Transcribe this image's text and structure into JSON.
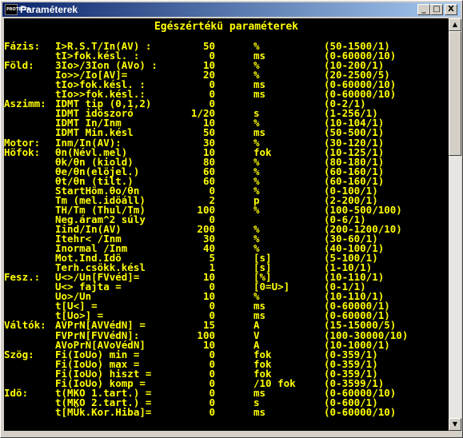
{
  "window": {
    "title": "Paraméterek",
    "app_icon_text": "PROTECTA"
  },
  "titlebar_buttons": {
    "minimize": "_",
    "maximize": "□",
    "close": "X"
  },
  "scrollbar": {
    "up": "▲",
    "down": "▼"
  },
  "header": "Egészértékü paraméterek",
  "rows": [
    {
      "group": "Fázis:",
      "name": "I>R.S.T/In(AV) :",
      "value": "50",
      "unit": "%",
      "range": "(50-1500/1)"
    },
    {
      "group": "",
      "name": "tI>fok.késl. :",
      "value": "0",
      "unit": "ms",
      "range": "(0-60000/10)"
    },
    {
      "group": "Föld:",
      "name": "3Io>/3Ion (AVo) :",
      "value": "10",
      "unit": "%",
      "range": "(10-200/1)"
    },
    {
      "group": "",
      "name": "Io>>/Io[AV]=",
      "value": "20",
      "unit": "%",
      "range": "(20-2500/5)"
    },
    {
      "group": "",
      "name": "tIo>fok.késl. :",
      "value": "0",
      "unit": "ms",
      "range": "(0-60000/10)"
    },
    {
      "group": "",
      "name": "tIo>>fok.késl.:",
      "value": "0",
      "unit": "ms",
      "range": "(0-60000/10)"
    },
    {
      "group": "Aszimm:",
      "name": "IDMT tip (0,1,2)",
      "value": "0",
      "unit": "",
      "range": "(0-2/1)"
    },
    {
      "group": "",
      "name": "IDMT idöszoró",
      "value": "1/20",
      "unit": "s",
      "range": "(1-256/1)"
    },
    {
      "group": "",
      "name": "IDMT In/Inm",
      "value": "10",
      "unit": "%",
      "range": "(10-104/1)"
    },
    {
      "group": "",
      "name": "IDMT Min.késl",
      "value": "50",
      "unit": "ms",
      "range": "(50-500/1)"
    },
    {
      "group": "Motor:",
      "name": "Inm/In(AV):",
      "value": "30",
      "unit": "%",
      "range": "(30-120/1)"
    },
    {
      "group": "Höfok:",
      "name": "θn(Névl.mel)",
      "value": "10",
      "unit": "fok",
      "range": "(10-125/1)"
    },
    {
      "group": "",
      "name": "θk/θn (kiold)",
      "value": "80",
      "unit": "%",
      "range": "(80-180/1)"
    },
    {
      "group": "",
      "name": "θe/θn(elöjel.)",
      "value": "60",
      "unit": "%",
      "range": "(60-160/1)"
    },
    {
      "group": "",
      "name": "θt/θn (tilt.)",
      "value": "60",
      "unit": "%",
      "range": "(60-160/1)"
    },
    {
      "group": "",
      "name": "StartHöm.θo/θn",
      "value": "0",
      "unit": "%",
      "range": "(0-100/1)"
    },
    {
      "group": "",
      "name": "Tm (mel.idöáll)",
      "value": "2",
      "unit": "p",
      "range": "(2-200/1)"
    },
    {
      "group": "",
      "name": "TH/Tm (Thul/Tm)",
      "value": "100",
      "unit": "%",
      "range": "(100-500/100)"
    },
    {
      "group": "",
      "name": "Neg.áram^2 súly",
      "value": "0",
      "unit": "",
      "range": "(0-6/1)"
    },
    {
      "group": "",
      "name": "Iind/In(AV)",
      "value": "200",
      "unit": "%",
      "range": "(200-1200/10)"
    },
    {
      "group": "",
      "name": "Itehr< /Inm",
      "value": "30",
      "unit": "%",
      "range": "(30-60/1)"
    },
    {
      "group": "",
      "name": "Inormal /Inm",
      "value": "40",
      "unit": "%",
      "range": "(40-100/1)"
    },
    {
      "group": "",
      "name": "Mot.Ind.Idö",
      "value": "5",
      "unit": "[s]",
      "range": "(5-100/1)"
    },
    {
      "group": "",
      "name": "Terh.csökk.késl",
      "value": "1",
      "unit": "[s]",
      "range": "(1-10/1)"
    },
    {
      "group": "Fesz.:",
      "name": "U<>/Un[FVvéd]=",
      "value": "10",
      "unit": "[%]",
      "range": "(10-110/1)"
    },
    {
      "group": "",
      "name": "U<> fajta =",
      "value": "0",
      "unit": "[0=U>]",
      "range": "(0-1/1)"
    },
    {
      "group": "",
      "name": "Uo>/Un",
      "value": "10",
      "unit": "%",
      "range": "(10-110/1)"
    },
    {
      "group": "",
      "name": "t[U<] =",
      "value": "0",
      "unit": "ms",
      "range": "(0-60000/1)"
    },
    {
      "group": "",
      "name": "t[Uo>] =",
      "value": "0",
      "unit": "ms",
      "range": "(0-60000/1)"
    },
    {
      "group": "Váltók:",
      "name": "AVPrN[AVVédN] =",
      "value": "15",
      "unit": "A",
      "range": "(15-15000/5)"
    },
    {
      "group": "",
      "name": "FVPrN[FVVédN]:",
      "value": "100",
      "unit": "V",
      "range": "(100-30000/10)"
    },
    {
      "group": "",
      "name": "AVoPrN[AVoVédN]",
      "value": "10",
      "unit": "A",
      "range": "(10-1000/1)"
    },
    {
      "group": "Szög:",
      "name": "Fi(IoUo) min =",
      "value": "0",
      "unit": "fok",
      "range": "(0-359/1)"
    },
    {
      "group": "",
      "name": "Fi(IoUo) max =",
      "value": "0",
      "unit": "fok",
      "range": "(0-359/1)"
    },
    {
      "group": "",
      "name": "Fi(IoUo) hiszt =",
      "value": "0",
      "unit": "fok",
      "range": "(0-359/1)"
    },
    {
      "group": "",
      "name": "Fi(IoUo) komp =",
      "value": "0",
      "unit": "/10 fok",
      "range": "(0-3599/1)"
    },
    {
      "group": "Idö:",
      "name": "t(MKO 1.tart.) =",
      "value": "0",
      "unit": "ms",
      "range": "(0-60000/10)"
    },
    {
      "group": "",
      "name": "t(MKO 2.tart.) =",
      "value": "0",
      "unit": "s",
      "range": "(0-600/1)"
    },
    {
      "group": "",
      "name": "t[MÜk.Kor.Hiba]=",
      "value": "0",
      "unit": "ms",
      "range": "(0-60000/10)"
    }
  ]
}
